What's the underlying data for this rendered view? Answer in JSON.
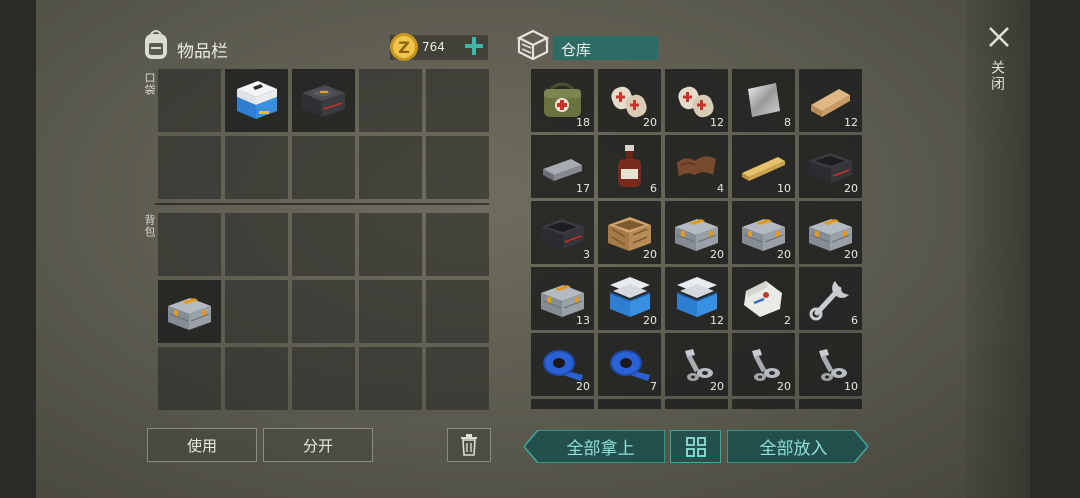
{
  "inventory": {
    "title": "物品栏",
    "coins": "764",
    "pocket_label": "口袋",
    "backpack_label": "背包",
    "pocket_items": [
      {
        "name": "blue-cooler-icon",
        "count": ""
      },
      {
        "name": "dark-ammo-case-icon",
        "count": ""
      }
    ],
    "backpack_items": [
      {
        "name": "gray-toolbox-icon",
        "count": ""
      }
    ]
  },
  "storage": {
    "title": "仓库",
    "items": [
      {
        "name": "medical-bag-icon",
        "count": "18"
      },
      {
        "name": "bandage-icon",
        "count": "20"
      },
      {
        "name": "bandage-icon",
        "count": "12"
      },
      {
        "name": "metal-plate-icon",
        "count": "8"
      },
      {
        "name": "wood-plank-icon",
        "count": "12"
      },
      {
        "name": "metal-bar-icon",
        "count": "17"
      },
      {
        "name": "brown-bottle-icon",
        "count": "6"
      },
      {
        "name": "leather-icon",
        "count": "4"
      },
      {
        "name": "board-icon",
        "count": "10"
      },
      {
        "name": "black-crate-icon",
        "count": "20"
      },
      {
        "name": "black-crate-icon",
        "count": "3"
      },
      {
        "name": "wooden-crate-icon",
        "count": "20"
      },
      {
        "name": "gray-toolbox-icon",
        "count": "20"
      },
      {
        "name": "gray-toolbox-icon",
        "count": "20"
      },
      {
        "name": "gray-toolbox-icon",
        "count": "20"
      },
      {
        "name": "gray-toolbox-icon",
        "count": "13"
      },
      {
        "name": "blue-cooler-open-icon",
        "count": "20"
      },
      {
        "name": "blue-cooler-open-icon",
        "count": "12"
      },
      {
        "name": "cement-bag-icon",
        "count": "2"
      },
      {
        "name": "wrench-icon",
        "count": "6"
      },
      {
        "name": "blue-tape-icon",
        "count": "20"
      },
      {
        "name": "blue-tape-icon",
        "count": "7"
      },
      {
        "name": "bolts-nuts-icon",
        "count": "20"
      },
      {
        "name": "bolts-nuts-icon",
        "count": "20"
      },
      {
        "name": "bolts-nuts-icon",
        "count": "10"
      }
    ]
  },
  "actions": {
    "use": "使用",
    "split": "分开",
    "take_all": "全部拿上",
    "put_all": "全部放入",
    "close": "关闭"
  },
  "colors": {
    "accent": "#2e8f86",
    "accent_text": "#8fe0d6",
    "coin": "#e6b83a",
    "plus": "#3fb6a8"
  }
}
